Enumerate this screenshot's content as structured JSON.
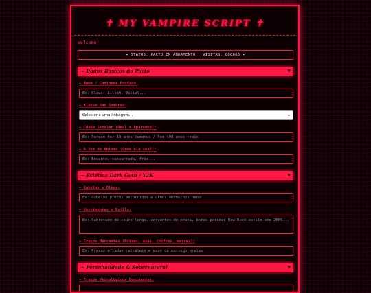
{
  "header": {
    "title": "✝ MY VAMPIRE SCRIPT ✝",
    "welcome": "Welcome!",
    "status": "✦ STATUS: PACTO EM ANDAMENTO | VISITAS: 000666 ✦"
  },
  "sections": [
    {
      "title": "~ Dados Básicos do Pacto",
      "arrow": "▼",
      "fields": [
        {
          "label": "✦ Nome / Codinome Profano:",
          "placeholder": "Ex: Klaus, Lilith, Belial..."
        },
        {
          "label": "✦ Classe das Sombras:",
          "select_value": "Selecione uma linhagem...",
          "chevron": "⌄"
        },
        {
          "label": "✦ Idade Secular (Real e Aparente):",
          "placeholder": "Ex: Parece ter 19 anos humanos / Tem 400 anos reais"
        },
        {
          "label": "✦ A Voz do Abismo (Como ela soa?):",
          "placeholder": "Ex: Ecoante, sussurrada, fria..."
        }
      ]
    },
    {
      "title": "~ Estética Dark Goth / Y2K",
      "arrow": "▼",
      "fields": [
        {
          "label": "✦ Cabelos e Olhos:",
          "placeholder": "Ex: Cabelos pretos escorridos e olhos vermelhos neon"
        },
        {
          "label": "✦ Vestimentas e Estilo:",
          "placeholder": "Ex: Sobretudo de couro longo, correntes de prata, botas pesadas New Rock estilo emo 2005...",
          "tall": true
        },
        {
          "label": "✦ Traços Marcantes (Presas, asas, chifres, marcas):",
          "placeholder": "Ex: Presas afiadas retráteis e asas de morcego pretas"
        }
      ]
    },
    {
      "title": "~ Personalidade & Sobrenatural",
      "arrow": "▼",
      "fields": [
        {
          "label": "✦ Traços Psicológicos Dominantes:",
          "placeholder": ""
        }
      ]
    }
  ]
}
